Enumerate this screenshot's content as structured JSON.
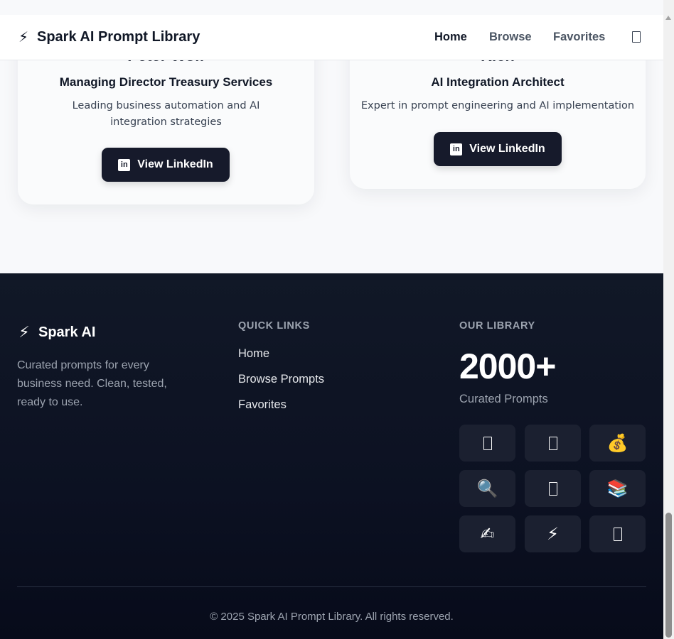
{
  "header": {
    "brand_icon": "⚡",
    "title": "Spark AI Prompt Library",
    "nav": [
      {
        "label": "Home",
        "active": true
      },
      {
        "label": "Browse",
        "active": false
      },
      {
        "label": "Favorites",
        "active": false
      }
    ],
    "theme_toggle_icon": "moon-icon"
  },
  "cards": [
    {
      "name_partial": "Peter Wolf",
      "role": "Managing Director Treasury Services",
      "description": "Leading business automation and AI integration strategies",
      "button_label": "View LinkedIn",
      "button_icon": "linkedin-icon"
    },
    {
      "name_partial": "Rich",
      "role": "AI Integration Architect",
      "description": "Expert in prompt engineering and AI implementation",
      "button_label": "View LinkedIn",
      "button_icon": "linkedin-icon"
    }
  ],
  "footer": {
    "brand_icon": "⚡",
    "brand": "Spark AI",
    "tagline": "Curated prompts for every business need. Clean, tested, ready to use.",
    "quick_links_heading": "QUICK LINKS",
    "quick_links": [
      "Home",
      "Browse Prompts",
      "Favorites"
    ],
    "library_heading": "OUR LIBRARY",
    "library_count": "2000+",
    "library_count_label": "Curated Prompts",
    "category_icons": [
      {
        "name": "category-icon",
        "glyph": ""
      },
      {
        "name": "category-icon",
        "glyph": ""
      },
      {
        "name": "money-bag-icon",
        "glyph": "💰"
      },
      {
        "name": "magnifier-icon",
        "glyph": "🔍"
      },
      {
        "name": "category-icon",
        "glyph": ""
      },
      {
        "name": "books-icon",
        "glyph": "📚"
      },
      {
        "name": "writing-hand-icon",
        "glyph": "✍"
      },
      {
        "name": "lightning-icon",
        "glyph": "⚡"
      },
      {
        "name": "category-icon",
        "glyph": ""
      }
    ],
    "copyright": "© 2025 Spark AI Prompt Library. All rights reserved."
  }
}
